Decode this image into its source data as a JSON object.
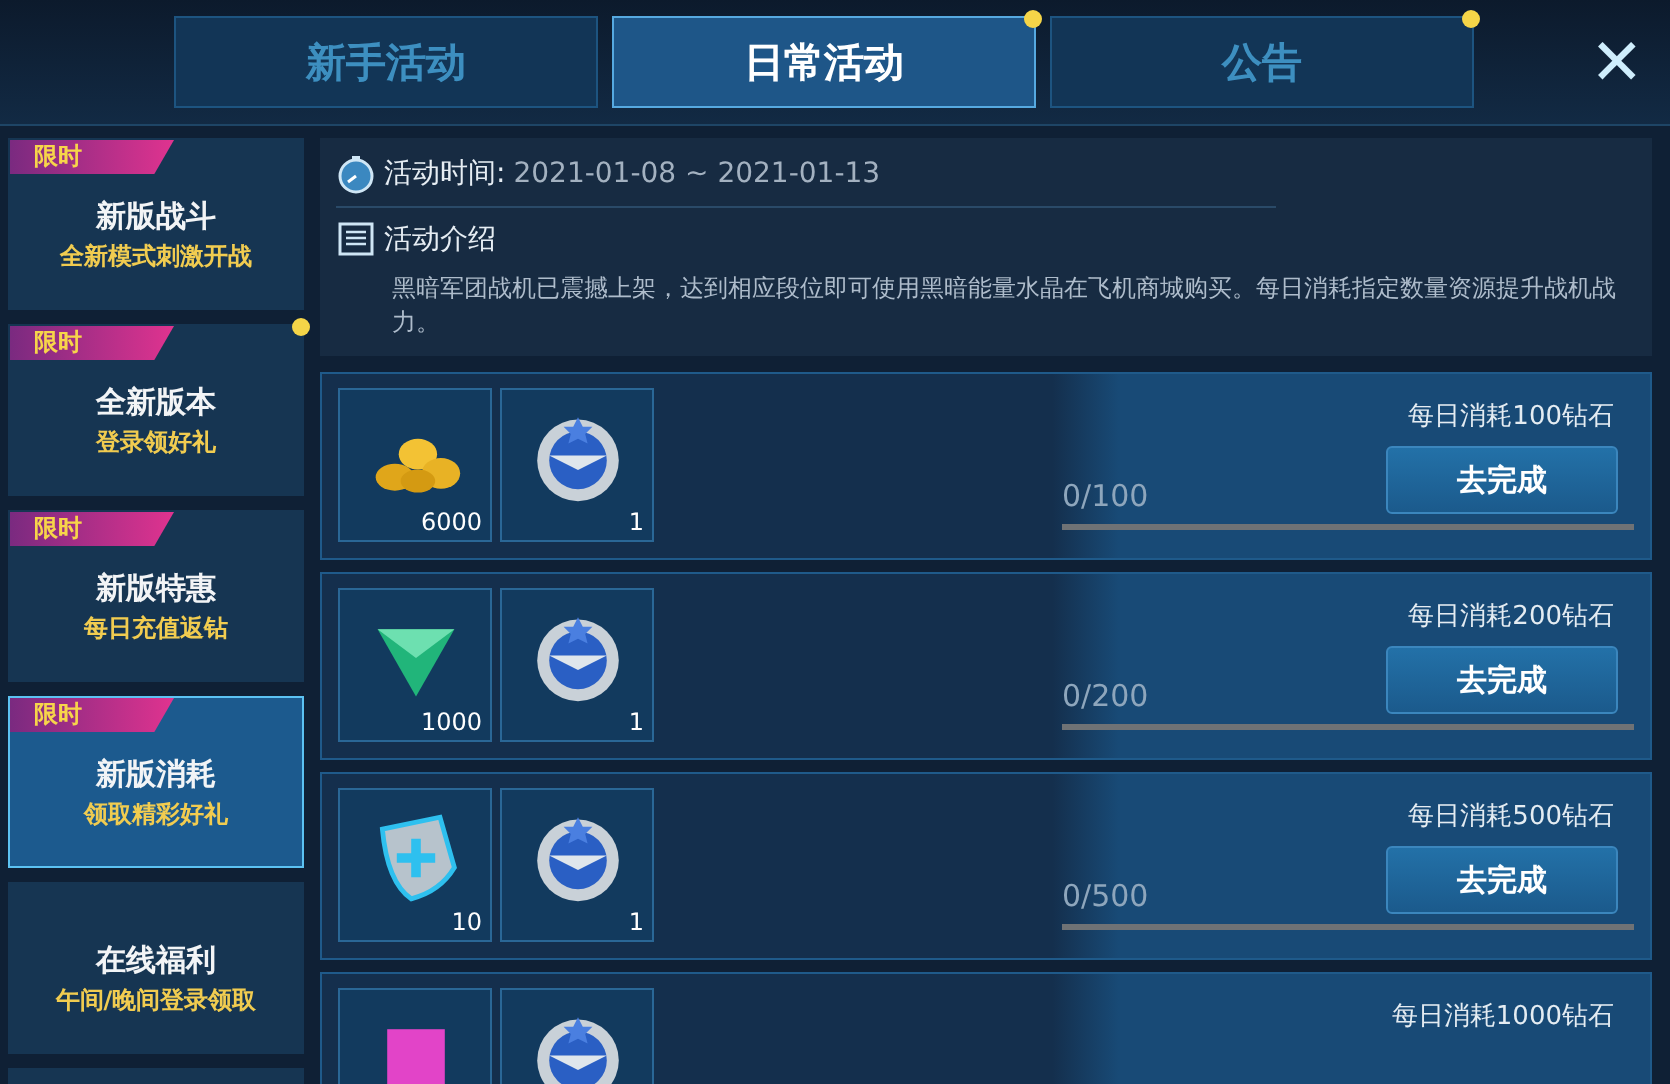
{
  "tabs": [
    {
      "label": "新手活动",
      "selected": false,
      "dot": false
    },
    {
      "label": "日常活动",
      "selected": true,
      "dot": true
    },
    {
      "label": "公告",
      "selected": false,
      "dot": true
    }
  ],
  "close_button": "✕",
  "sidebar": {
    "items": [
      {
        "tag": "限时",
        "title": "新版战斗",
        "subtitle": "全新模式刺激开战",
        "selected": false,
        "dot": false
      },
      {
        "tag": "限时",
        "title": "全新版本",
        "subtitle": "登录领好礼",
        "selected": false,
        "dot": true
      },
      {
        "tag": "限时",
        "title": "新版特惠",
        "subtitle": "每日充值返钻",
        "selected": false,
        "dot": false
      },
      {
        "tag": "限时",
        "title": "新版消耗",
        "subtitle": "领取精彩好礼",
        "selected": true,
        "dot": false
      },
      {
        "title": "在线福利",
        "subtitle": "午间/晚间登录领取",
        "selected": false,
        "dot": false
      },
      {
        "selected": false,
        "dot": false
      }
    ]
  },
  "info": {
    "time_label": "活动时间:",
    "time_value": "2021-01-08 ~ 2021-01-13",
    "intro_title": "活动介绍",
    "intro_text": "黑暗军团战机已震撼上架，达到相应段位即可使用黑暗能量水晶在飞机商城购买。每日消耗指定数量资源提升战机战力。"
  },
  "tasks": [
    {
      "rewards": [
        {
          "kind": "coins",
          "count": "6000"
        },
        {
          "kind": "badge",
          "count": "1"
        }
      ],
      "goal": "每日消耗100钻石",
      "progress": "0/100",
      "level": 0,
      "button": "去完成"
    },
    {
      "rewards": [
        {
          "kind": "gem",
          "count": "1000"
        },
        {
          "kind": "badge",
          "count": "1"
        }
      ],
      "goal": "每日消耗200钻石",
      "progress": "0/200",
      "level": 0,
      "button": "去完成"
    },
    {
      "rewards": [
        {
          "kind": "shield",
          "count": "10"
        },
        {
          "kind": "badge",
          "count": "1"
        }
      ],
      "goal": "每日消耗500钻石",
      "progress": "0/500",
      "level": 0,
      "button": "去完成"
    },
    {
      "rewards": [
        {
          "kind": "box"
        },
        {
          "kind": "badge"
        }
      ],
      "goal": "每日消耗1000钻石"
    }
  ]
}
